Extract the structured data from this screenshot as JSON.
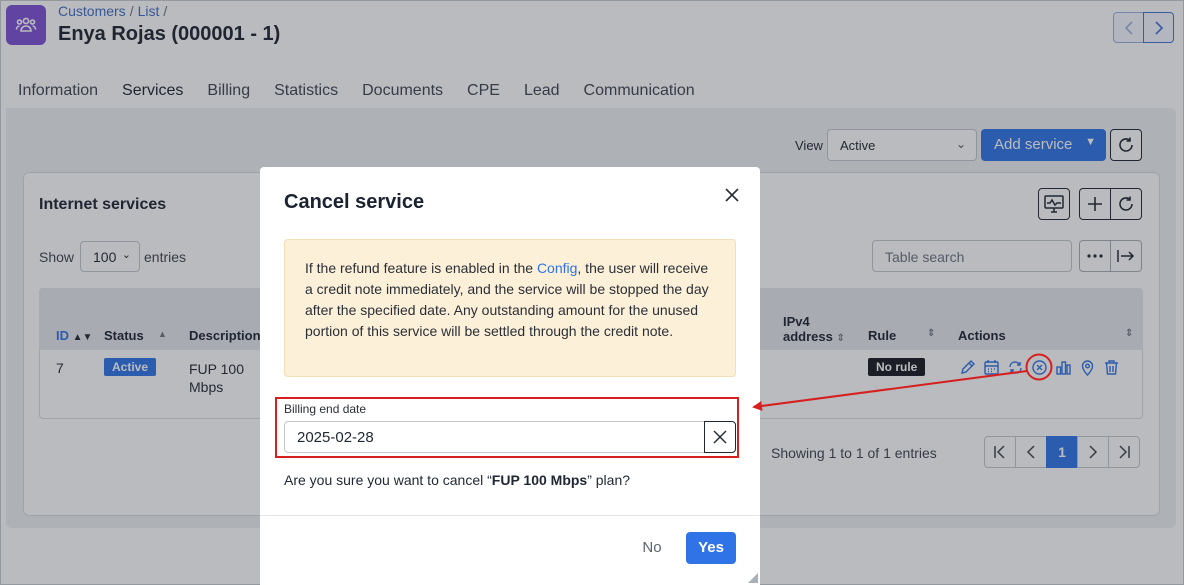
{
  "breadcrumb": {
    "items": [
      "Customers",
      "List"
    ]
  },
  "header": {
    "title": "Enya Rojas (000001 - 1)"
  },
  "tabs": [
    "Information",
    "Services",
    "Billing",
    "Statistics",
    "Documents",
    "CPE",
    "Lead",
    "Communication"
  ],
  "active_tab": "Services",
  "toolbar": {
    "view_label": "View",
    "view_value": "Active",
    "add_service_label": "Add service"
  },
  "card": {
    "title": "Internet services",
    "show_label": "Show",
    "show_value": "100",
    "entries_label": "entries",
    "search_placeholder": "Table search"
  },
  "table": {
    "columns": {
      "id": "ID",
      "status": "Status",
      "description": "Description",
      "ipv4_line1": "IPv4",
      "ipv4_line2": "address",
      "rule": "Rule",
      "actions": "Actions"
    },
    "row": {
      "id": "7",
      "status": "Active",
      "description_line1": "FUP 100",
      "description_line2": "Mbps",
      "rule": "No rule"
    },
    "action_icons": [
      "edit-icon",
      "calendar-icon",
      "change-icon",
      "cancel-circle-icon",
      "stats-icon",
      "map-pin-icon",
      "trash-icon"
    ]
  },
  "pagination": {
    "info": "Showing 1 to 1 of 1 entries",
    "current_page": "1"
  },
  "modal": {
    "title": "Cancel service",
    "alert": {
      "before_link": "If the refund feature is enabled in the ",
      "link": "Config",
      "after_link": ", the user will receive a credit note immediately, and the service will be stopped the day after the specified date. Any outstanding amount for the unused portion of this service will be settled through the credit note."
    },
    "field_label": "Billing end date",
    "field_value": "2025-02-28",
    "confirm_before": "Are you sure you want to cancel “",
    "confirm_plan": "FUP 100 Mbps",
    "confirm_after": "” plan?",
    "no_label": "No",
    "yes_label": "Yes"
  },
  "colors": {
    "accent": "#2f73e6",
    "app_icon": "#7d4fd6",
    "alert_bg": "#fdf0d9",
    "annotation": "#d62020"
  }
}
